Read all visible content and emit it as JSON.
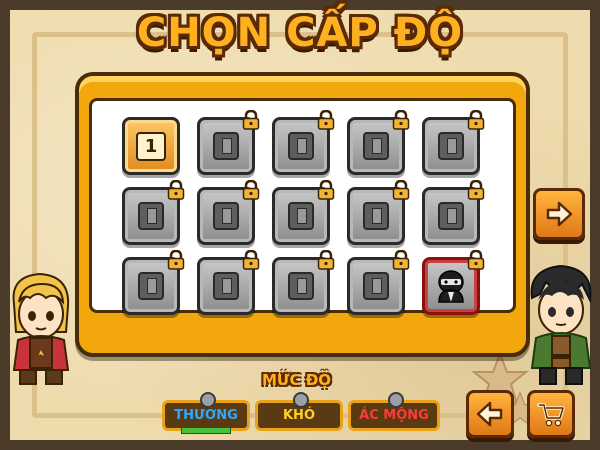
{
  "title": "CHỌN CẤP ĐỘ",
  "levels": [
    {
      "label": "1",
      "state": "unlocked"
    },
    {
      "label": "",
      "state": "locked"
    },
    {
      "label": "",
      "state": "locked"
    },
    {
      "label": "",
      "state": "locked"
    },
    {
      "label": "",
      "state": "locked"
    },
    {
      "label": "",
      "state": "locked"
    },
    {
      "label": "",
      "state": "locked"
    },
    {
      "label": "",
      "state": "locked"
    },
    {
      "label": "",
      "state": "locked"
    },
    {
      "label": "",
      "state": "locked"
    },
    {
      "label": "",
      "state": "locked"
    },
    {
      "label": "",
      "state": "locked"
    },
    {
      "label": "",
      "state": "locked"
    },
    {
      "label": "",
      "state": "locked"
    },
    {
      "label": "",
      "state": "boss-locked"
    }
  ],
  "difficulty": {
    "label": "MỨC ĐỘ",
    "options": [
      {
        "label": "THƯỜNG",
        "color": "#2fa8ff",
        "selected": true
      },
      {
        "label": "KHÓ",
        "color": "#ffd11a",
        "selected": false
      },
      {
        "label": "ÁC MỘNG",
        "color": "#ff3a3a",
        "selected": false
      }
    ]
  },
  "icons": {
    "next": "arrow-right-icon",
    "back": "arrow-left-icon",
    "shop": "shopping-cart-icon",
    "lock": "padlock-icon"
  },
  "colors": {
    "title": "#ffb01f",
    "board": "#f2a70d",
    "button": "#e07818"
  }
}
